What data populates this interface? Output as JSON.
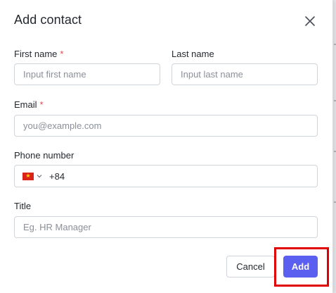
{
  "dialog": {
    "title": "Add contact",
    "close_icon": "close-icon"
  },
  "form": {
    "first_name": {
      "label": "First name",
      "required_mark": "*",
      "value": "",
      "placeholder": "Input first name"
    },
    "last_name": {
      "label": "Last name",
      "value": "",
      "placeholder": "Input last name"
    },
    "email": {
      "label": "Email",
      "required_mark": "*",
      "value": "",
      "placeholder": "you@example.com"
    },
    "phone": {
      "label": "Phone number",
      "country_flag_icon": "vietnam-flag-icon",
      "dropdown_icon": "chevron-down-icon",
      "dial_code": "+84",
      "value": ""
    },
    "title": {
      "label": "Title",
      "value": "",
      "placeholder": "Eg. HR Manager"
    }
  },
  "actions": {
    "cancel_label": "Cancel",
    "add_label": "Add"
  },
  "colors": {
    "primary": "#5b5ff0",
    "required": "#e5484d",
    "highlight": "#e00000"
  }
}
